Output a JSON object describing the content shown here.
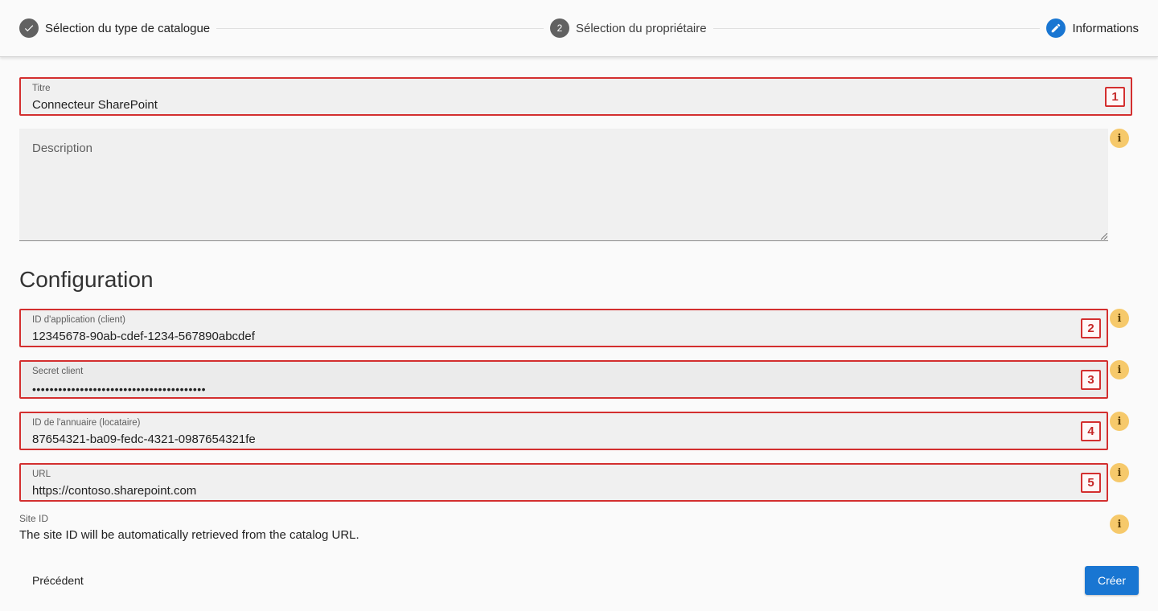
{
  "stepper": {
    "steps": [
      {
        "label": "Sélection du type de catalogue",
        "state": "done",
        "icon": "check-icon"
      },
      {
        "label": "Sélection du propriétaire",
        "state": "pending",
        "number": "2"
      },
      {
        "label": "Informations",
        "state": "active",
        "icon": "pencil-icon"
      }
    ]
  },
  "form": {
    "title": {
      "label": "Titre",
      "value": "Connecteur SharePoint",
      "badge": "1"
    },
    "description": {
      "placeholder": "Description"
    }
  },
  "configuration": {
    "heading": "Configuration",
    "fields": [
      {
        "label": "ID d'application (client)",
        "value": "12345678-90ab-cdef-1234-567890abcdef",
        "badge": "2"
      },
      {
        "label": "Secret client",
        "value": "••••••••••••••••••••••••••••••••••••••••",
        "badge": "3"
      },
      {
        "label": "ID de l'annuaire (locataire)",
        "value": "87654321-ba09-fedc-4321-0987654321fe",
        "badge": "4"
      },
      {
        "label": "URL",
        "value": "https://contoso.sharepoint.com",
        "badge": "5"
      }
    ],
    "site_id": {
      "label": "Site ID",
      "text": "The site ID will be automatically retrieved from the catalog URL."
    }
  },
  "info_icon": "i",
  "actions": {
    "back": "Précédent",
    "create": "Créer"
  },
  "colors": {
    "accent": "#1976d2",
    "highlight": "#d32f2f",
    "info": "#f6c96b"
  }
}
